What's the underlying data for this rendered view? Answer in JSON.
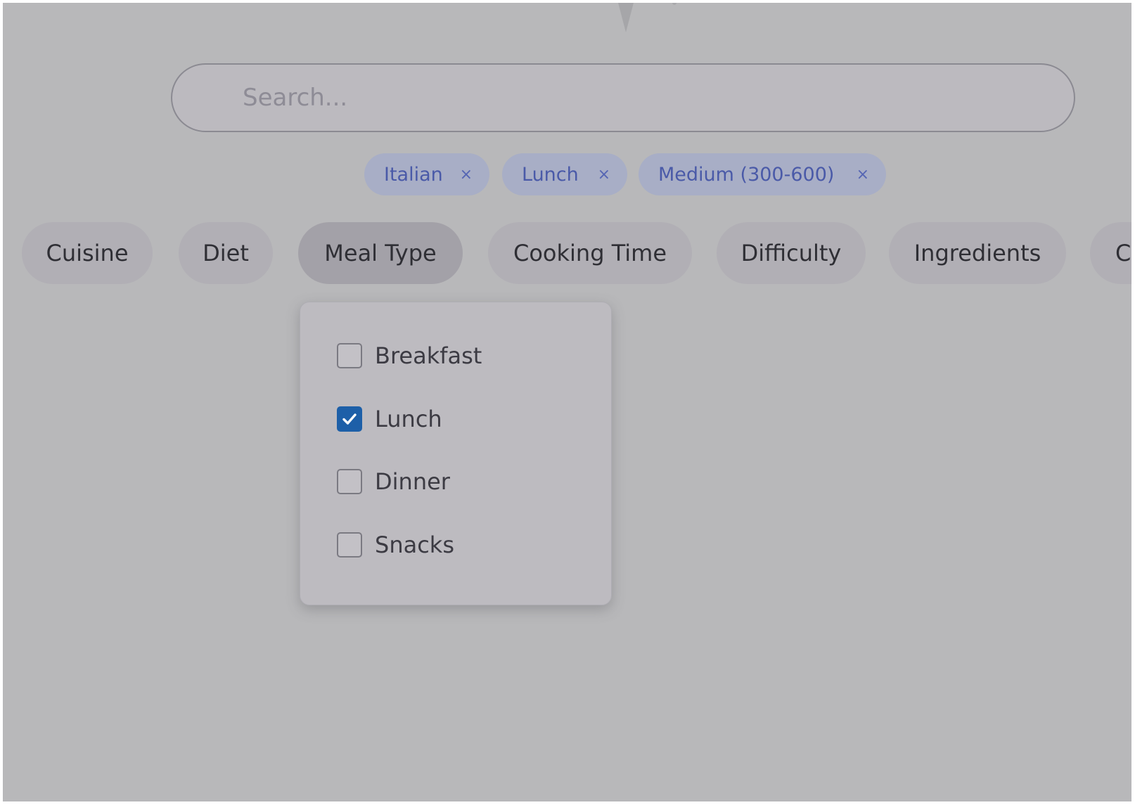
{
  "search": {
    "placeholder": "Search..."
  },
  "active_filters": [
    {
      "label": "Italian",
      "remove": "×"
    },
    {
      "label": "Lunch",
      "remove": "×"
    },
    {
      "label": "Medium (300-600)",
      "remove": "×"
    }
  ],
  "filter_tabs": [
    {
      "label": "Cuisine"
    },
    {
      "label": "Diet"
    },
    {
      "label": "Meal Type",
      "active": true
    },
    {
      "label": "Cooking Time"
    },
    {
      "label": "Difficulty"
    },
    {
      "label": "Ingredients"
    },
    {
      "label": "C"
    }
  ],
  "meal_type_dropdown": {
    "options": [
      {
        "label": "Breakfast",
        "checked": false
      },
      {
        "label": "Lunch",
        "checked": true
      },
      {
        "label": "Dinner",
        "checked": false
      },
      {
        "label": "Snacks",
        "checked": false
      }
    ]
  },
  "colors": {
    "chip_bg": "#a8aec6",
    "chip_text": "#4a5aa8",
    "checkbox_checked": "#1d5fa8",
    "overlay": "#b8b8ba"
  }
}
